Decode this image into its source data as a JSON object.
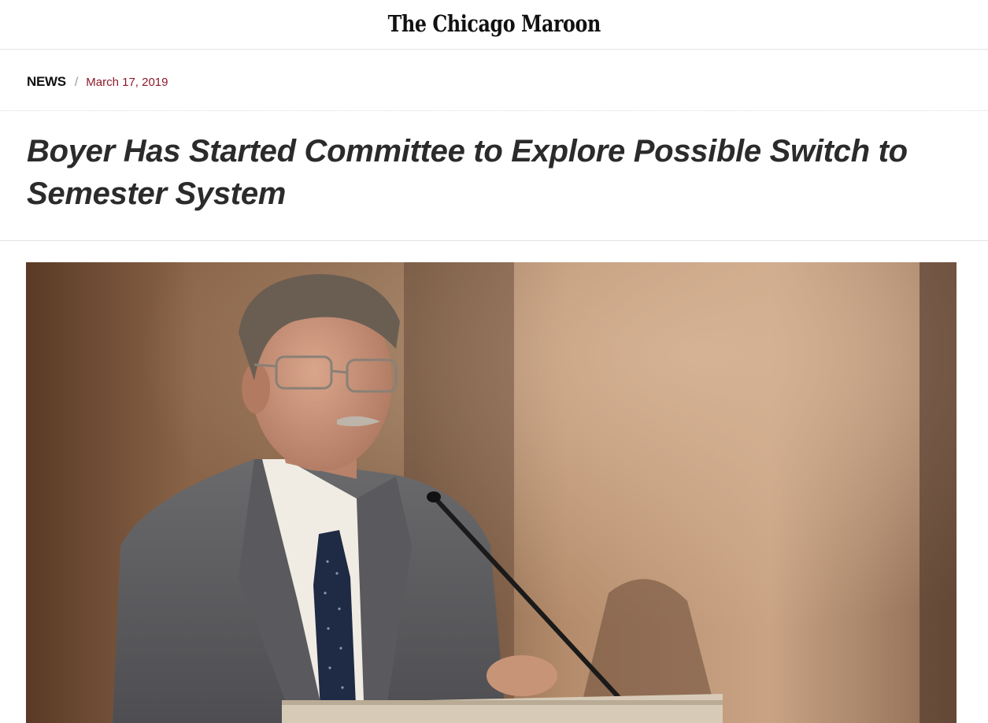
{
  "site": {
    "logo_text": "The Chicago Maroon"
  },
  "breadcrumb": {
    "section": "NEWS",
    "separator": "/",
    "date": "March 17, 2019"
  },
  "article": {
    "headline": "Boyer Has Started Committee to Explore Possible Switch to Semester System"
  },
  "photo": {
    "subject": "man in gray suit speaking at podium with microphone"
  },
  "colors": {
    "date_accent": "#8b1a2a",
    "headline": "#2b2b2b",
    "divider": "#e3e3e3"
  }
}
